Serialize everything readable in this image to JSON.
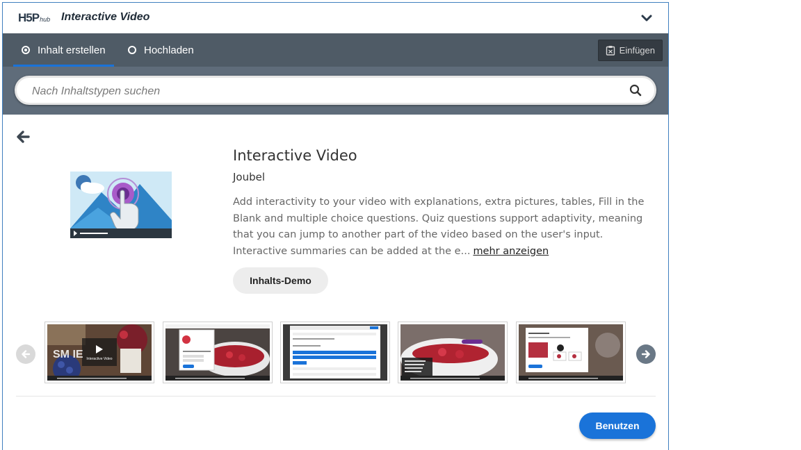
{
  "header": {
    "logo_text": "H5P",
    "logo_suffix": "hub",
    "title": "Interactive Video",
    "collapse_icon": "chevron-down-icon"
  },
  "tabs": [
    {
      "label": "Inhalt erstellen",
      "selected": true
    },
    {
      "label": "Hochladen",
      "selected": false
    }
  ],
  "paste": {
    "label": "Einfügen",
    "icon": "clipboard-icon"
  },
  "search": {
    "placeholder": "Nach Inhaltstypen suchen",
    "icon": "search-icon"
  },
  "detail": {
    "back_icon": "arrow-left-icon",
    "title": "Interactive Video",
    "owner": "Joubel",
    "description": "Add interactivity to your video with explanations, extra pictures, tables, Fill in the Blank and multiple choice questions. Quiz questions support adaptivity, meaning that you can jump to another part of the video based on the user's input. Interactive summaries can be added at the e...",
    "more_label": "mehr anzeigen",
    "demo_label": "Inhalts-Demo"
  },
  "carousel": {
    "prev_icon": "arrow-left-circle-icon",
    "next_icon": "arrow-right-circle-icon",
    "thumb1_caption": "Interactive Video",
    "thumb1_overlay": "SM    IE"
  },
  "footer": {
    "use_label": "Benutzen"
  },
  "colors": {
    "accent": "#1a73d9",
    "tabbar": "#4f5b66",
    "searchbar": "#5f6c7a"
  }
}
